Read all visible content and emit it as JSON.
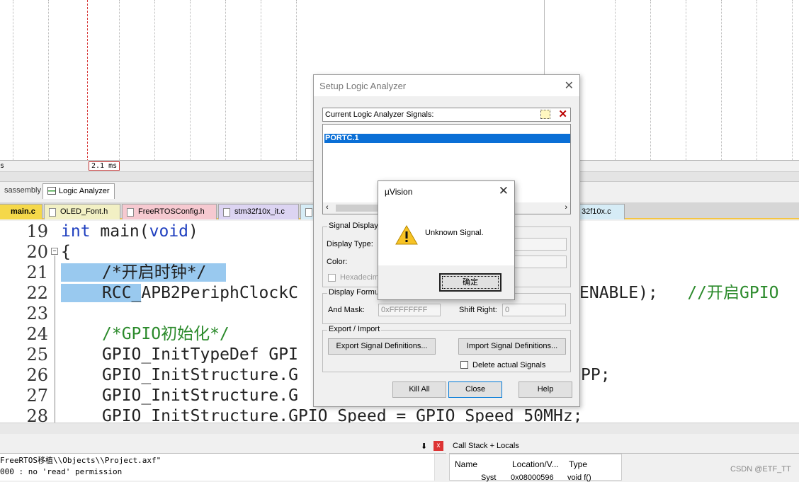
{
  "logic_analyzer": {
    "scale_left": "s",
    "time_label": "2.1 ms"
  },
  "panel_tabs": {
    "disassembly": "sassembly",
    "logic_analyzer": "Logic Analyzer"
  },
  "file_tabs": [
    {
      "label": "main.c",
      "color": "#f5d84a"
    },
    {
      "label": "OLED_Font.h",
      "color": "#f2f0c4"
    },
    {
      "label": "FreeRTOSConfig.h",
      "color": "#f6c9d0"
    },
    {
      "label": "stm32f10x_it.c",
      "color": "#dcd4f2"
    },
    {
      "label": "32f10x.c",
      "color": "#d6ecf6"
    }
  ],
  "editor": {
    "lines": [
      {
        "n": "19"
      },
      {
        "n": "20"
      },
      {
        "n": "21"
      },
      {
        "n": "22"
      },
      {
        "n": "23"
      },
      {
        "n": "24"
      },
      {
        "n": "25"
      },
      {
        "n": "26"
      },
      {
        "n": "27"
      },
      {
        "n": "28"
      }
    ],
    "code": {
      "l19_kw1": "int",
      "l19_mid": " main(",
      "l19_kw2": "void",
      "l19_end": ")",
      "l20": "{",
      "l21": "/*开启时钟*/",
      "l22_sel": "RCC_",
      "l22_a": "APB2PeriphClockC",
      "l22_b": "ENABLE);   ",
      "l22_cm": "//开启GPIO",
      "l24": "/*GPIO初始化*/",
      "l25": "GPIO_InitTypeDef GPI",
      "l26": "GPIO_InitStructure.G",
      "l26_r": "PP;",
      "l27": "GPIO_InitStructure.G",
      "l28": "GPIO_InitStructure.GPIO_Speed = GPIO_Speed_50MHz;"
    }
  },
  "build_output": {
    "line1": "FreeRTOS移植\\\\Objects\\\\Project.axf\"",
    "line2": "000 : no 'read' permission",
    "pin": "⬇",
    "close": "x"
  },
  "call_stack": {
    "title": "Call Stack + Locals",
    "columns": [
      "Name",
      "Location/V...",
      "Type"
    ],
    "row": {
      "name": "Syst",
      "location": "0x08000596",
      "type": "void f()"
    }
  },
  "watermark": "CSDN @ETF_TT",
  "setup_dialog": {
    "title": "Setup Logic Analyzer",
    "signals_header": "Current Logic Analyzer Signals:",
    "signals": [
      "PORTC.1"
    ],
    "signal_display": {
      "group": "Signal Display",
      "display_type": "Display Type:",
      "color": "Color:",
      "hexadecimal": "Hexadecim"
    },
    "display_formula": {
      "group": "Display Formula",
      "and_mask_label": "And Mask:",
      "and_mask_value": "0xFFFFFFFF",
      "shift_right_label": "Shift Right:",
      "shift_right_value": "0"
    },
    "export_import": {
      "group": "Export / Import",
      "export_btn": "Export Signal Definitions...",
      "import_btn": "Import Signal Definitions...",
      "delete_actual": "Delete actual Signals"
    },
    "buttons": {
      "kill_all": "Kill All",
      "close": "Close",
      "help": "Help"
    }
  },
  "message_box": {
    "title": "µVision",
    "text": "Unknown Signal.",
    "ok": "确定"
  }
}
